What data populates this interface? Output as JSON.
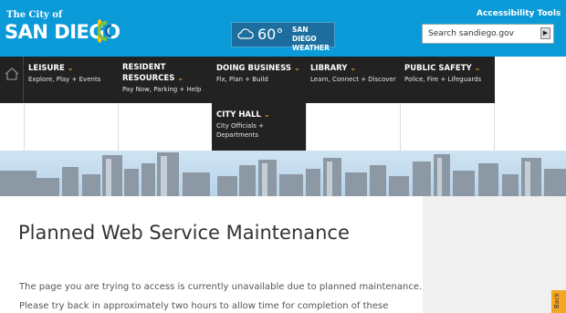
{
  "header": {
    "logo_small": "The City of",
    "logo_big": "SAN DIEGO",
    "accessibility": "Accessibility Tools",
    "search_placeholder": "Search sandiego.gov",
    "weather": {
      "temp": "60°",
      "line1": "SAN DIEGO",
      "line2": "WEATHER"
    },
    "colors": {
      "header_bg": "#0a9ad8",
      "nav_bg": "#222222",
      "accent": "#f5a623"
    }
  },
  "nav": {
    "home_icon": "home-icon",
    "items": [
      {
        "title": "LEISURE",
        "sub": "Explore, Play + Events"
      },
      {
        "title": "RESIDENT RESOURCES",
        "sub": "Pay Now, Parking + Help"
      },
      {
        "title": "DOING BUSINESS",
        "sub": "Fix, Plan + Build"
      },
      {
        "title": "LIBRARY",
        "sub": "Learn, Connect + Discover"
      },
      {
        "title": "PUBLIC SAFETY",
        "sub": "Police, Fire + Lifeguards"
      },
      {
        "title": "CITY HALL",
        "sub": "City Officials + Departments"
      }
    ]
  },
  "main": {
    "title": "Planned Web Service Maintenance",
    "p1": "The page you are trying to access is currently unavailable due to planned maintenance.",
    "p2": "Please try back in approximately two hours to allow time for completion of these"
  },
  "back_tab": "Back"
}
